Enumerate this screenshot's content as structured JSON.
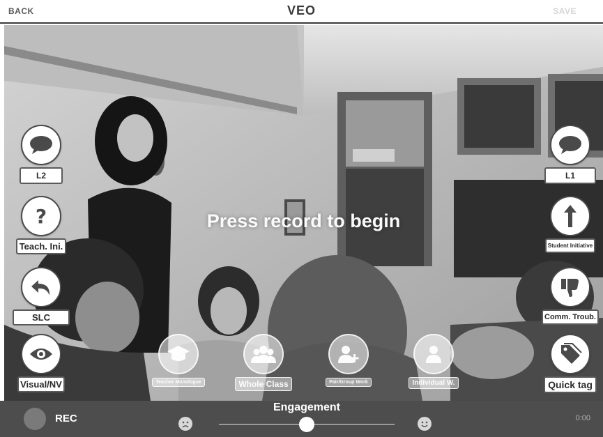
{
  "header": {
    "back_label": "BACK",
    "title": "VEO",
    "save_label": "SAVE"
  },
  "video": {
    "prompt": "Press record to begin"
  },
  "left_tags": [
    {
      "label": "L2",
      "icon": "speech-bubble-icon"
    },
    {
      "label": "Teach. Ini.",
      "icon": "question-mark-icon"
    },
    {
      "label": "SLC",
      "icon": "undo-arrow-icon"
    },
    {
      "label": "Visual/NV",
      "icon": "eye-icon"
    }
  ],
  "right_tags": [
    {
      "label": "L1",
      "icon": "speech-bubble-icon"
    },
    {
      "label": "Student Initiative",
      "icon": "up-arrow-icon"
    },
    {
      "label": "Comm. Troub.",
      "icon": "thumbs-down-icon"
    },
    {
      "label": "Quick tag",
      "icon": "tags-icon"
    }
  ],
  "bottom_tags": [
    {
      "label": "Teacher Monologue",
      "icon": "graduation-cap-icon"
    },
    {
      "label": "Whole Class",
      "icon": "group-icon"
    },
    {
      "label": "Pair/Group Work",
      "icon": "add-user-icon"
    },
    {
      "label": "Individual W.",
      "icon": "single-user-icon"
    }
  ],
  "footer": {
    "rec_label": "REC",
    "engagement_label": "Engagement",
    "engagement_level": 0.5,
    "timer": "0:00"
  },
  "colors": {
    "top_bar": "#ffffff",
    "bottom_bar": "#4d4d4d",
    "button_fill": "#ffffff",
    "button_border": "#4a4a4a"
  }
}
